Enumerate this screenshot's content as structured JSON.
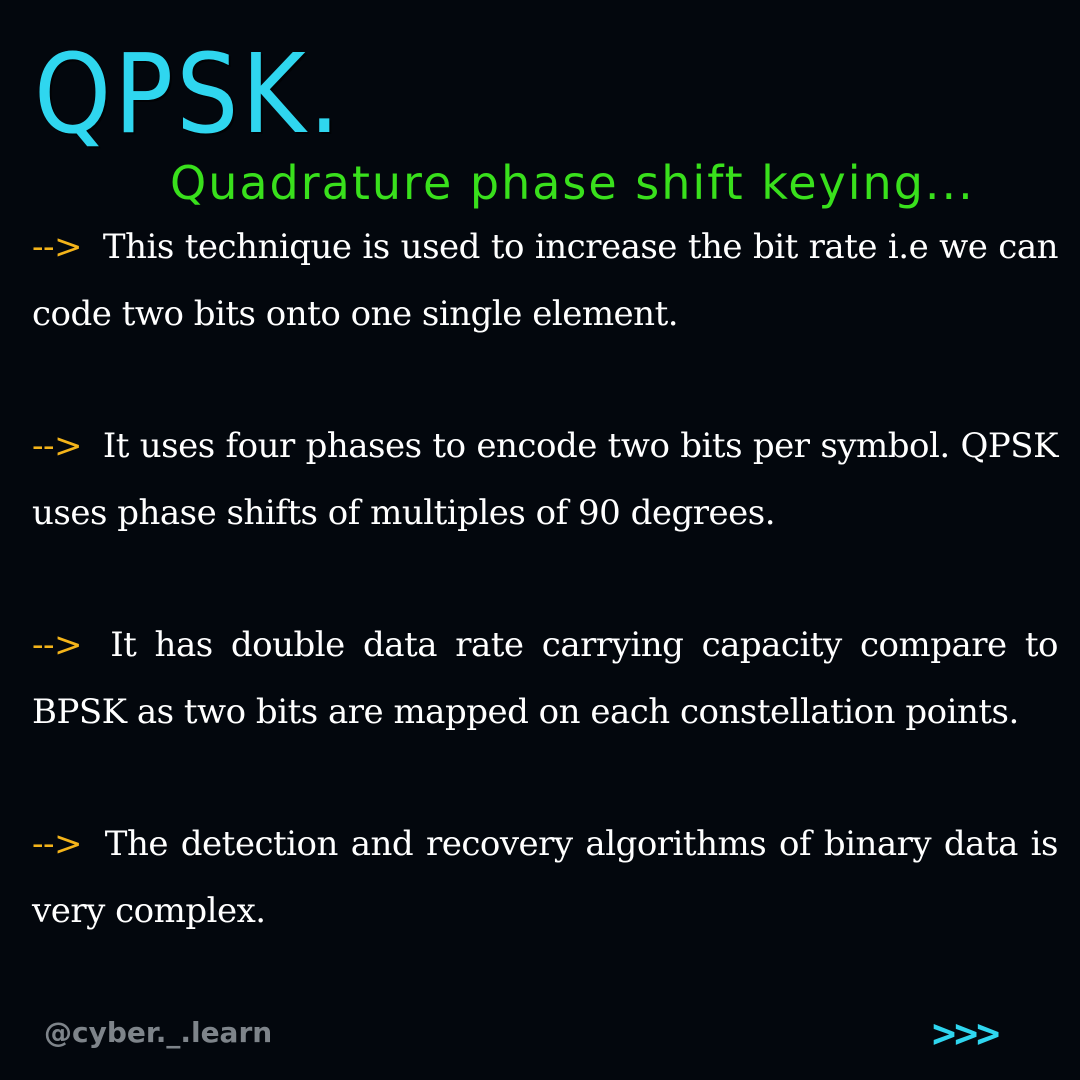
{
  "header": {
    "title": "QPSK.",
    "subtitle": "Quadrature phase shift keying..."
  },
  "points": [
    {
      "marker": "-->",
      "text": "This technique is used to increase the bit rate i.e we can code two bits onto one single element."
    },
    {
      "marker": "-->",
      "text": "It uses four phases to encode two bits per symbol. QPSK uses phase shifts of multiples of 90 degrees."
    },
    {
      "marker": "-->",
      "text": "It has double data rate carrying capacity compare to BPSK as two bits are mapped on each constellation points."
    },
    {
      "marker": "-->",
      "text": "The detection and recovery algorithms of binary data is very complex."
    }
  ],
  "footer": {
    "handle": "@cyber._.learn",
    "next": ">>>"
  },
  "colors": {
    "background": "#03070d",
    "title": "#2fd6ef",
    "subtitle": "#39e01c",
    "marker": "#f4b41a",
    "body_text": "#ffffff",
    "handle": "#7e848a",
    "next": "#2fd6ef"
  }
}
